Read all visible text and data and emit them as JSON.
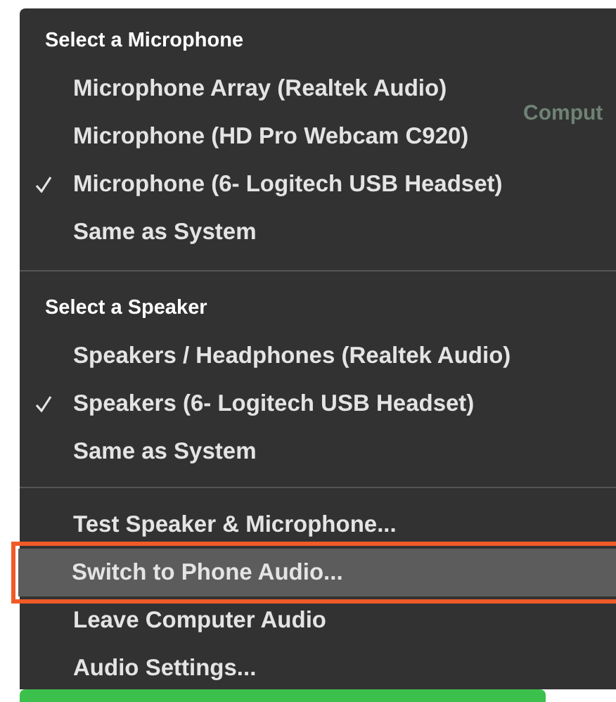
{
  "sections": [
    {
      "header": "Select a Microphone",
      "items": [
        {
          "label": "Microphone Array (Realtek Audio)",
          "checked": false
        },
        {
          "label": "Microphone (HD Pro Webcam C920)",
          "checked": false
        },
        {
          "label": "Microphone (6- Logitech USB Headset)",
          "checked": true
        },
        {
          "label": "Same as System",
          "checked": false
        }
      ]
    },
    {
      "header": "Select a Speaker",
      "items": [
        {
          "label": "Speakers / Headphones (Realtek Audio)",
          "checked": false
        },
        {
          "label": "Speakers (6- Logitech USB Headset)",
          "checked": true
        },
        {
          "label": "Same as System",
          "checked": false
        }
      ]
    }
  ],
  "actions": [
    {
      "label": "Test Speaker & Microphone...",
      "highlighted": false
    },
    {
      "label": "Switch to Phone Audio...",
      "highlighted": true
    },
    {
      "label": "Leave Computer Audio",
      "highlighted": false
    },
    {
      "label": "Audio Settings...",
      "highlighted": false
    }
  ],
  "background_text": "Comput"
}
